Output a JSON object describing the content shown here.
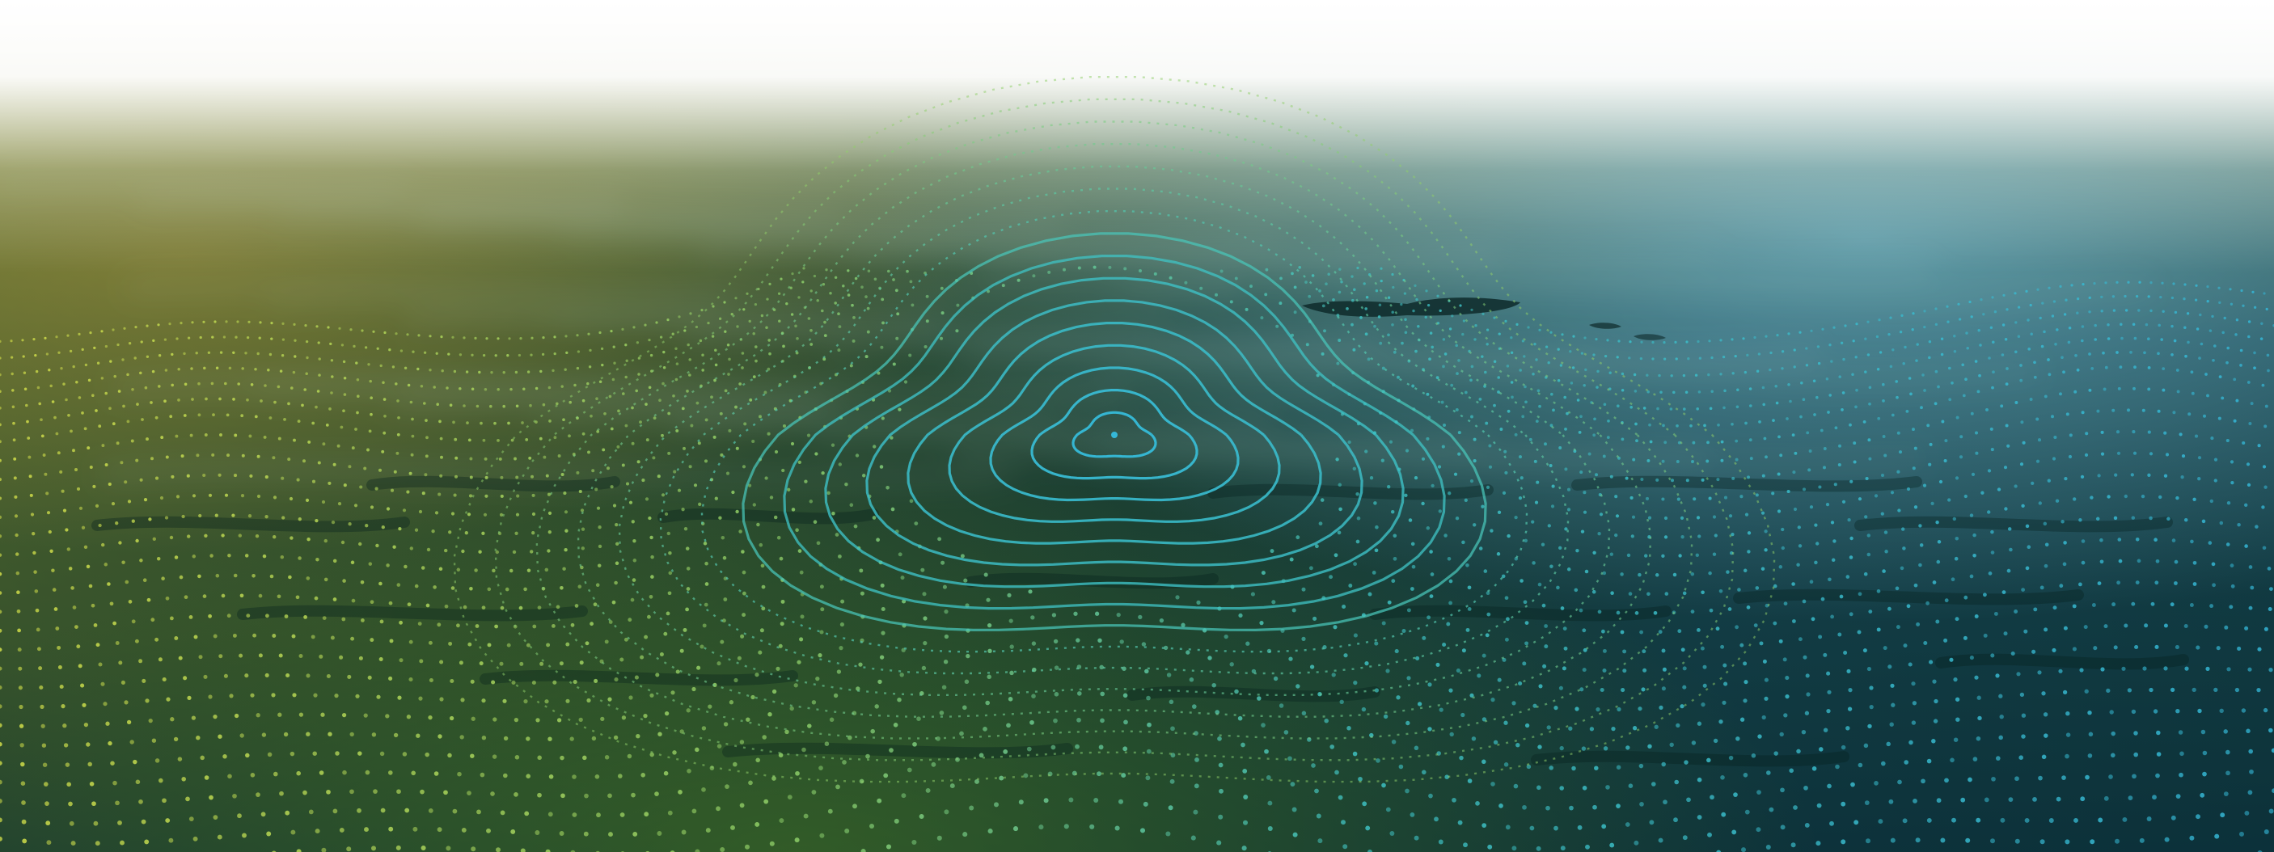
{
  "scene": {
    "palette": {
      "sky": "#ffffff",
      "haze_warm": "#b9b27a",
      "haze_cool": "#8fc6cf",
      "water_left": "#4f6b2a",
      "water_mid": "#1c3f34",
      "water_right": "#123a48",
      "water_bottom": "#0b2c2c",
      "dot_yellow": "#d4e04a",
      "dot_green": "#8fd06a",
      "dot_teal": "#3fc3c4",
      "dot_cyan": "#35b8d8",
      "island": "#0e2a2a"
    },
    "icons": [
      "contour-topography-graphic",
      "dotted-wave-grid-graphic"
    ]
  }
}
